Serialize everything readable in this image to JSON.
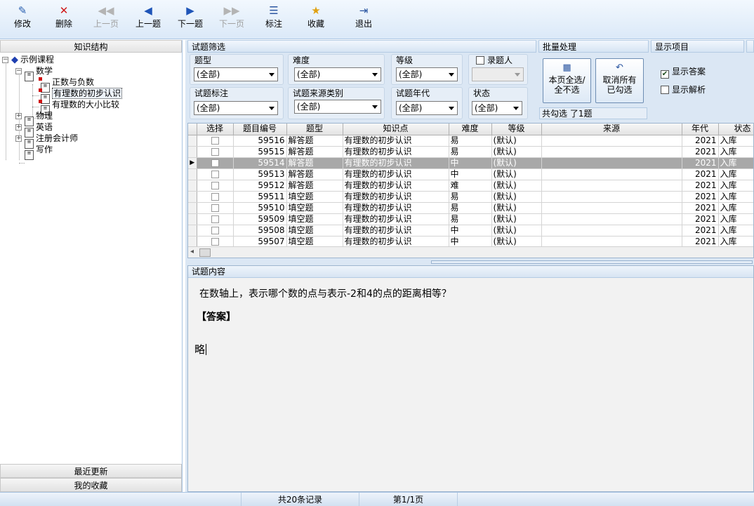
{
  "toolbar": {
    "edit": "修改",
    "delete": "删除",
    "prev_page": "上一页",
    "prev_question": "上一题",
    "next_question": "下一题",
    "next_page": "下一页",
    "mark": "标注",
    "favorite": "收藏",
    "exit": "退出"
  },
  "left_panel": {
    "header": "知识结构",
    "tree": {
      "root": "示例课程",
      "math": "数学",
      "math_children": [
        "正数与负数",
        "有理数的初步认识",
        "有理数的大小比较"
      ],
      "physics": "物理",
      "english": "英语",
      "cpa": "注册会计师",
      "writing": "写作"
    },
    "recent": "最近更新",
    "favorites": "我的收藏"
  },
  "filter": {
    "title": "试题筛选",
    "type_label": "题型",
    "type_value": "(全部)",
    "difficulty_label": "难度",
    "difficulty_value": "(全部)",
    "level_label": "等级",
    "level_value": "(全部)",
    "recorder_label": "录题人",
    "recorder_value": "",
    "tag_label": "试题标注",
    "tag_value": "(全部)",
    "source_label": "试题来源类别",
    "source_value": "(全部)",
    "year_label": "试题年代",
    "year_value": "(全部)",
    "status_label": "状态",
    "status_value": "(全部)"
  },
  "batch": {
    "title": "批量处理",
    "select_page_line1": "本页全选/",
    "select_page_line2": "全不选",
    "cancel_line1": "取消所有",
    "cancel_line2": "已勾选",
    "summary": "共勾选  了1题"
  },
  "display": {
    "title": "显示项目",
    "show_answer": "显示答案",
    "show_answer_checked": true,
    "show_analysis": "显示解析",
    "show_analysis_checked": false
  },
  "grid": {
    "columns": [
      "选择",
      "题目编号",
      "题型",
      "知识点",
      "难度",
      "等级",
      "来源",
      "年代",
      "状态"
    ],
    "rows": [
      {
        "id": "59516",
        "type": "解答题",
        "kp": "有理数的初步认识",
        "diff": "易",
        "level": "(默认)",
        "source": "",
        "year": "2021",
        "status": "入库"
      },
      {
        "id": "59515",
        "type": "解答题",
        "kp": "有理数的初步认识",
        "diff": "易",
        "level": "(默认)",
        "source": "",
        "year": "2021",
        "status": "入库"
      },
      {
        "id": "59514",
        "type": "解答题",
        "kp": "有理数的初步认识",
        "diff": "中",
        "level": "(默认)",
        "source": "",
        "year": "2021",
        "status": "入库"
      },
      {
        "id": "59513",
        "type": "解答题",
        "kp": "有理数的初步认识",
        "diff": "中",
        "level": "(默认)",
        "source": "",
        "year": "2021",
        "status": "入库"
      },
      {
        "id": "59512",
        "type": "解答题",
        "kp": "有理数的初步认识",
        "diff": "难",
        "level": "(默认)",
        "source": "",
        "year": "2021",
        "status": "入库"
      },
      {
        "id": "59511",
        "type": "填空题",
        "kp": "有理数的初步认识",
        "diff": "易",
        "level": "(默认)",
        "source": "",
        "year": "2021",
        "status": "入库"
      },
      {
        "id": "59510",
        "type": "填空题",
        "kp": "有理数的初步认识",
        "diff": "易",
        "level": "(默认)",
        "source": "",
        "year": "2021",
        "status": "入库"
      },
      {
        "id": "59509",
        "type": "填空题",
        "kp": "有理数的初步认识",
        "diff": "易",
        "level": "(默认)",
        "source": "",
        "year": "2021",
        "status": "入库"
      },
      {
        "id": "59508",
        "type": "填空题",
        "kp": "有理数的初步认识",
        "diff": "中",
        "level": "(默认)",
        "source": "",
        "year": "2021",
        "status": "入库"
      },
      {
        "id": "59507",
        "type": "填空题",
        "kp": "有理数的初步认识",
        "diff": "中",
        "level": "(默认)",
        "source": "",
        "year": "2021",
        "status": "入库"
      }
    ]
  },
  "content": {
    "title": "试题内容",
    "question": "在数轴上，表示哪个数的点与表示-2和4的点的距离相等？",
    "answer_label": "【答案】",
    "answer": "略"
  },
  "status_bar": {
    "records": "共20条记录",
    "page": "第1/1页"
  }
}
